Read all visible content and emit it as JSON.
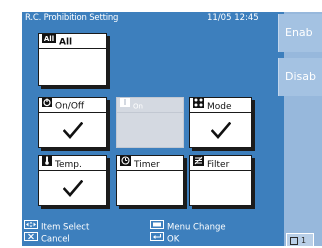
{
  "header": {
    "title": "R.C. Prohibition Setting",
    "datetime": "11/05 12:45"
  },
  "side_buttons": {
    "enable": "Enab",
    "disable": "Disab"
  },
  "cards": {
    "all": {
      "label": "All",
      "checked": false,
      "icon": "all-icon"
    },
    "on_off": {
      "label": "On/Off",
      "checked": true,
      "icon": "power-icon"
    },
    "on": {
      "label": "On",
      "checked": false,
      "disabled": true,
      "icon": "on-icon"
    },
    "mode": {
      "label": "Mode",
      "checked": true,
      "icon": "mode-icon"
    },
    "temp": {
      "label": "Temp.",
      "checked": true,
      "icon": "thermometer-icon"
    },
    "timer": {
      "label": "Timer",
      "checked": false,
      "icon": "clock-icon"
    },
    "filter": {
      "label": "Filter",
      "checked": false,
      "icon": "filter-icon"
    }
  },
  "footer": {
    "item_select": "Item Select",
    "cancel": "Cancel",
    "menu_change": "Menu Change",
    "ok": "OK"
  },
  "page_indicator": "1",
  "colors": {
    "screen_bg": "#3d7fbd",
    "side_bg": "#97b8dc",
    "card_bg": "#ffffff",
    "disabled_bg": "#d4d9e1"
  }
}
